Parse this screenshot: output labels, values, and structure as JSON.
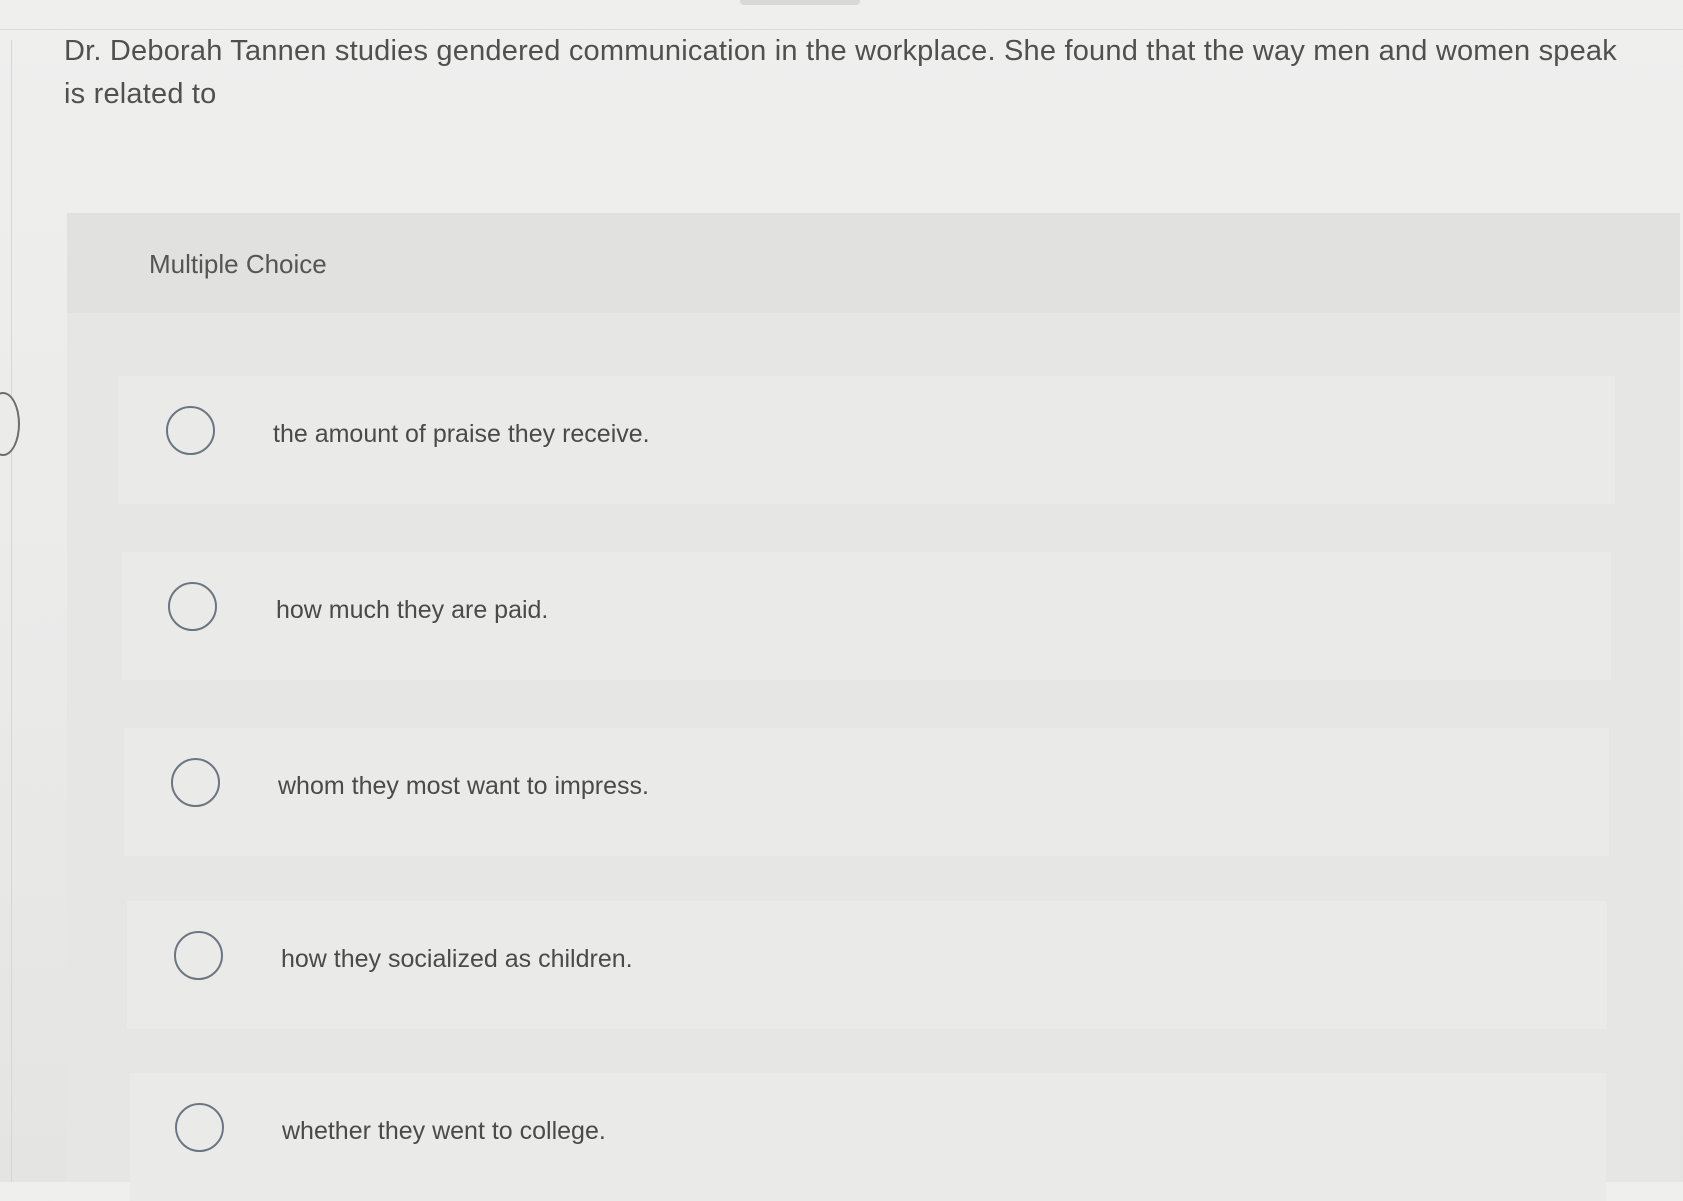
{
  "question": {
    "text": "Dr. Deborah Tannen studies gendered communication in the workplace. She found that the way men and women speak is related to"
  },
  "section": {
    "label": "Multiple Choice"
  },
  "options": [
    {
      "label": "the amount of praise they receive.",
      "selected": false
    },
    {
      "label": "how much they are paid.",
      "selected": false
    },
    {
      "label": "whom they most want to impress.",
      "selected": false
    },
    {
      "label": "how they socialized as children.",
      "selected": false
    },
    {
      "label": "whether they went to college.",
      "selected": false
    }
  ]
}
